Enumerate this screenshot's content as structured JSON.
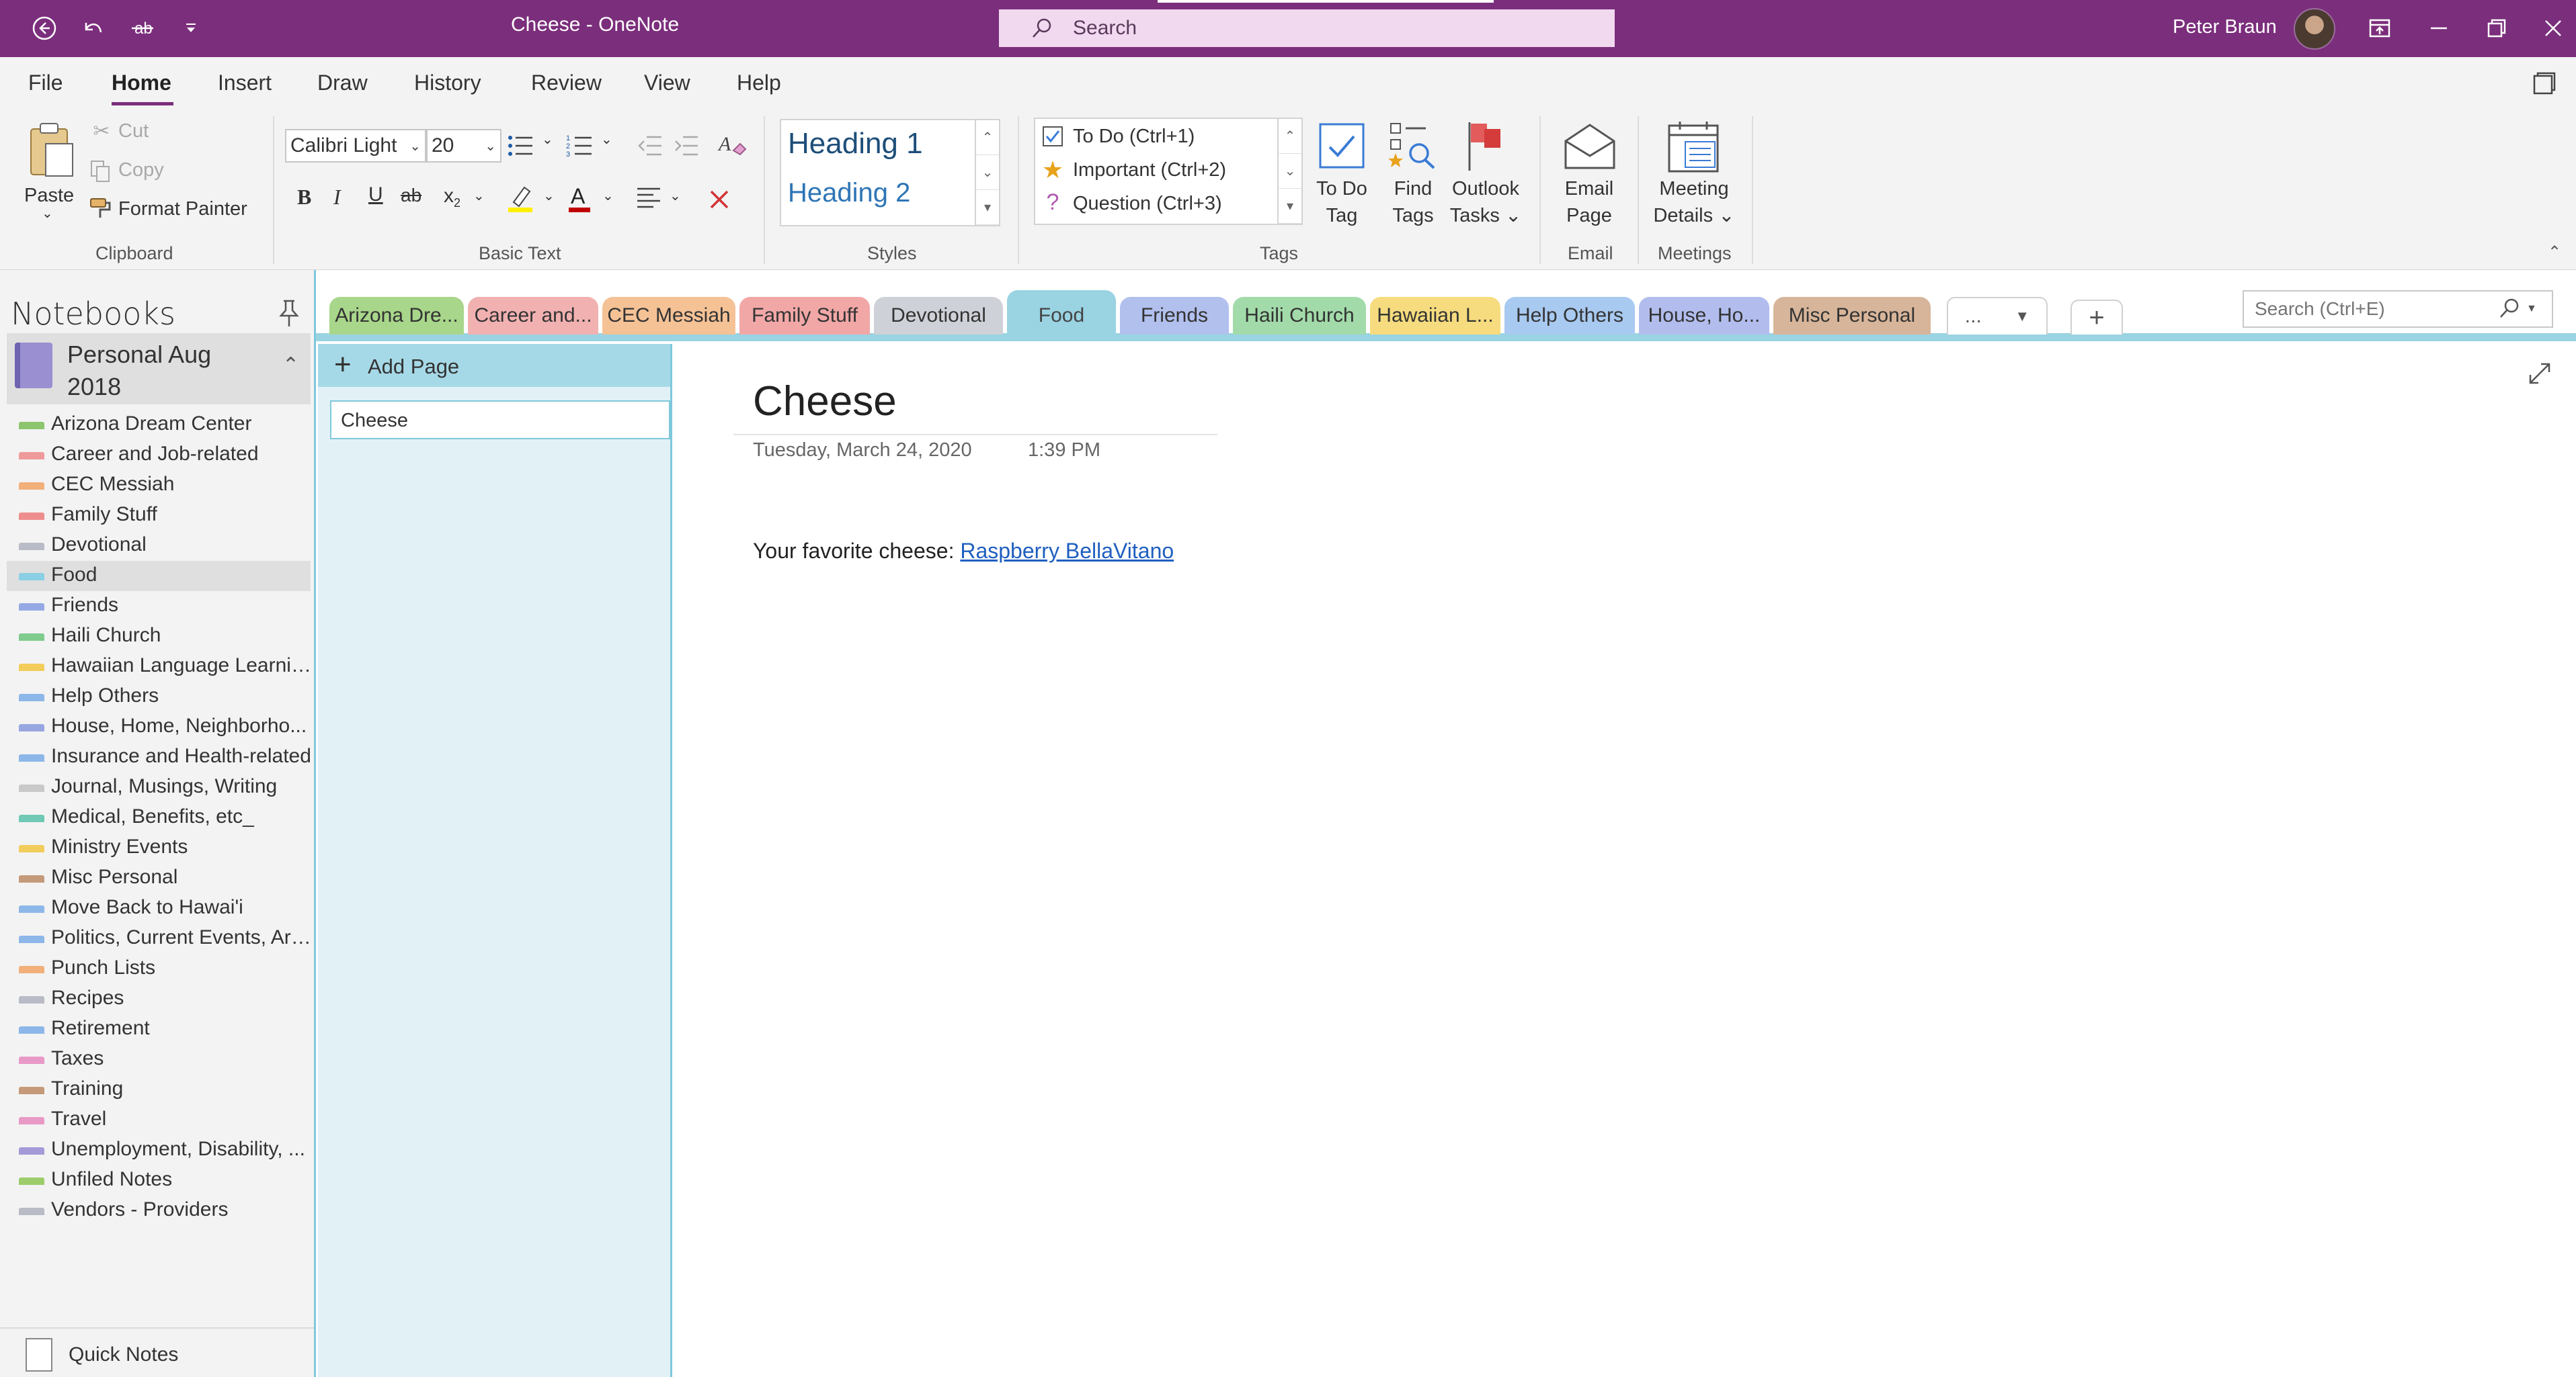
{
  "window": {
    "title": "Cheese  -  OneNote",
    "search_placeholder": "Search",
    "user_name": "Peter Braun"
  },
  "menu": {
    "tabs": [
      "File",
      "Home",
      "Insert",
      "Draw",
      "History",
      "Review",
      "View",
      "Help"
    ],
    "active": "Home"
  },
  "ribbon": {
    "clipboard": {
      "paste": "Paste",
      "cut": "Cut",
      "copy": "Copy",
      "format_painter": "Format Painter",
      "group": "Clipboard"
    },
    "basic_text": {
      "font": "Calibri Light",
      "size": "20",
      "group": "Basic Text"
    },
    "styles": {
      "heading1": "Heading 1",
      "heading2": "Heading 2",
      "group": "Styles"
    },
    "tags": {
      "todo": "To Do (Ctrl+1)",
      "important": "Important (Ctrl+2)",
      "question": "Question (Ctrl+3)",
      "todo_tag_1": "To Do",
      "todo_tag_2": "Tag",
      "find_tags_1": "Find",
      "find_tags_2": "Tags",
      "outlook_1": "Outlook",
      "outlook_2": "Tasks",
      "group": "Tags"
    },
    "email": {
      "label_1": "Email",
      "label_2": "Page",
      "group": "Email"
    },
    "meetings": {
      "label_1": "Meeting",
      "label_2": "Details",
      "group": "Meetings"
    }
  },
  "notebooks": {
    "heading": "Notebooks",
    "current": "Personal Aug 2018",
    "sections": [
      {
        "label": "Arizona Dream Center",
        "color": "#8cc56d"
      },
      {
        "label": "Career and Job-related",
        "color": "#ee9a9a"
      },
      {
        "label": "CEC Messiah",
        "color": "#f1b07a"
      },
      {
        "label": "Family Stuff",
        "color": "#ee8d8d"
      },
      {
        "label": "Devotional",
        "color": "#b9bcc6"
      },
      {
        "label": "Food",
        "color": "#8acfe3"
      },
      {
        "label": "Friends",
        "color": "#95a9e4"
      },
      {
        "label": "Haili Church",
        "color": "#7fcc8e"
      },
      {
        "label": "Hawaiian Language Learning",
        "color": "#f2cd5b"
      },
      {
        "label": "Help Others",
        "color": "#8cb7e8"
      },
      {
        "label": "House, Home, Neighborho...",
        "color": "#98a7e0"
      },
      {
        "label": "Insurance and Health-related",
        "color": "#8cb7e8"
      },
      {
        "label": "Journal, Musings, Writing",
        "color": "#c9c9c9"
      },
      {
        "label": "Medical, Benefits, etc_",
        "color": "#6fc9b4"
      },
      {
        "label": "Ministry Events",
        "color": "#f2cd5b"
      },
      {
        "label": "Misc Personal",
        "color": "#c49a7a"
      },
      {
        "label": "Move Back to Hawai'i",
        "color": "#8cb7e8"
      },
      {
        "label": "Politics, Current Events, Arti...",
        "color": "#8cb7e8"
      },
      {
        "label": "Punch Lists",
        "color": "#f1b07a"
      },
      {
        "label": "Recipes",
        "color": "#b9bcc6"
      },
      {
        "label": "Retirement",
        "color": "#8cb7e8"
      },
      {
        "label": "Taxes",
        "color": "#e89ac7"
      },
      {
        "label": "Training",
        "color": "#c49a7a"
      },
      {
        "label": "Travel",
        "color": "#e89ac7"
      },
      {
        "label": "Unemployment, Disability, ...",
        "color": "#a59ad8"
      },
      {
        "label": "Unfiled Notes",
        "color": "#9ccd6a"
      },
      {
        "label": "Vendors - Providers",
        "color": "#b9bcc6"
      }
    ],
    "active_section": "Food",
    "quick_notes": "Quick Notes"
  },
  "section_tabs": {
    "tabs": [
      {
        "label": "Arizona Dre...",
        "color": "#a8d68a"
      },
      {
        "label": "Career and...",
        "color": "#f2b1b1"
      },
      {
        "label": "CEC Messiah",
        "color": "#f5c296"
      },
      {
        "label": "Family Stuff",
        "color": "#f2a7a7"
      },
      {
        "label": "Devotional",
        "color": "#cfd1d8"
      },
      {
        "label": "Food",
        "color": "#9ad3e2"
      },
      {
        "label": "Friends",
        "color": "#b2c0ee"
      },
      {
        "label": "Haili Church",
        "color": "#a2dba9"
      },
      {
        "label": "Hawaiian L...",
        "color": "#f6dc7e"
      },
      {
        "label": "Help Others",
        "color": "#a8c9f0"
      },
      {
        "label": "House, Ho...",
        "color": "#b2bdee"
      },
      {
        "label": "Misc Personal",
        "color": "#d7b59a"
      }
    ],
    "more": "...",
    "add": "+",
    "search_placeholder": "Search (Ctrl+E)"
  },
  "pages": {
    "add_page": "Add Page",
    "items": [
      "Cheese"
    ]
  },
  "page": {
    "title": "Cheese",
    "date": "Tuesday, March 24, 2020",
    "time": "1:39 PM",
    "body_prefix": "Your favorite cheese: ",
    "link_text": "Raspberry BellaVitano"
  }
}
